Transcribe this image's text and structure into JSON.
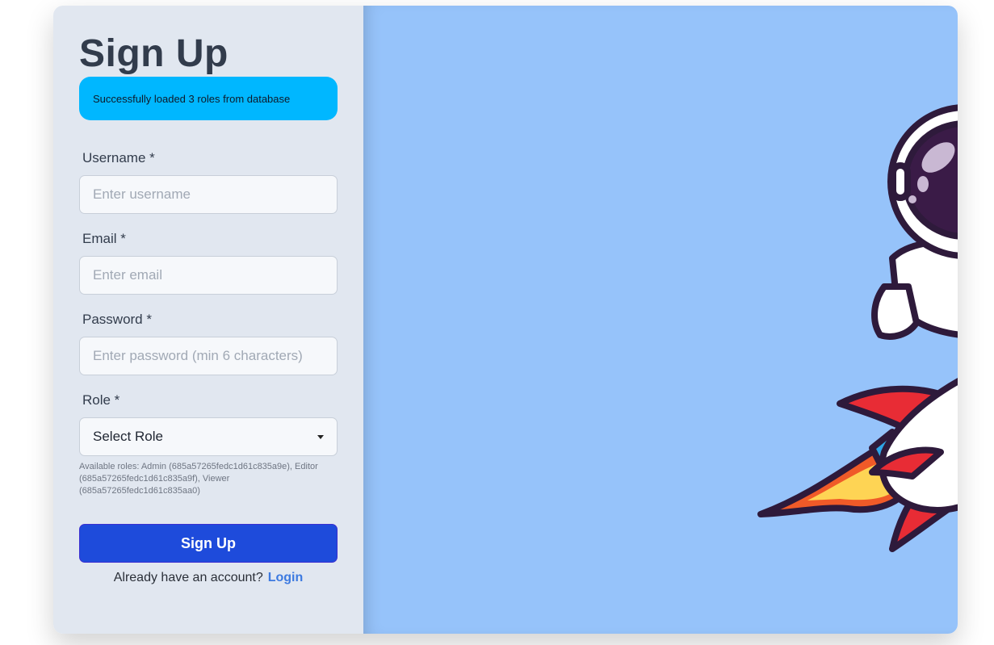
{
  "form": {
    "title": "Sign Up",
    "alert": "Successfully loaded 3 roles from database",
    "username_label": "Username *",
    "username_placeholder": "Enter username",
    "email_label": "Email *",
    "email_placeholder": "Enter email",
    "password_label": "Password *",
    "password_placeholder": "Enter password (min 6 characters)",
    "role_label": "Role *",
    "role_selected": "Select Role",
    "roles_hint": "Available roles: Admin (685a57265fedc1d61c835a9e), Editor (685a57265fedc1d61c835a9f), Viewer (685a57265fedc1d61c835aa0)",
    "submit_label": "Sign Up",
    "footer_text": "Already have an account?",
    "login_link": "Login"
  },
  "colors": {
    "form_background": "#e1e7f0",
    "hero_background": "#96c3fa",
    "alert": "#00b7ff",
    "primary_button": "#1e4bdb",
    "link": "#3d7ae0"
  },
  "hero": {
    "icon": "astronaut-riding-rocket-illustration"
  }
}
